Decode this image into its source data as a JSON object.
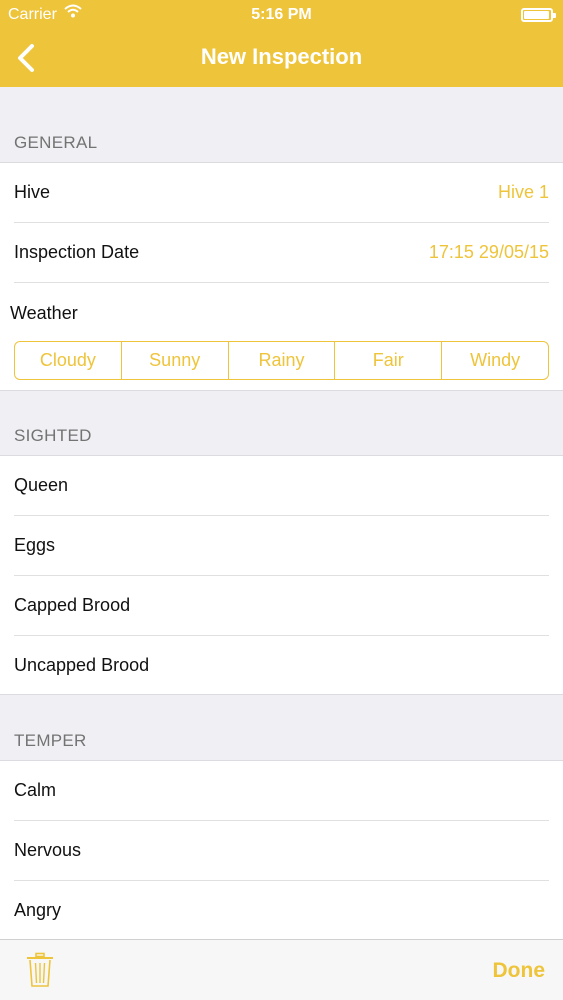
{
  "status_bar": {
    "carrier": "Carrier",
    "time": "5:16 PM",
    "battery_level": 0.95
  },
  "nav": {
    "title": "New Inspection",
    "back_icon": "chevron-left-icon"
  },
  "general": {
    "title": "GENERAL",
    "hive": {
      "label": "Hive",
      "value": "Hive 1"
    },
    "date": {
      "label": "Inspection Date",
      "value": "17:15 29/05/15"
    },
    "weather": {
      "label": "Weather",
      "options": [
        "Cloudy",
        "Sunny",
        "Rainy",
        "Fair",
        "Windy"
      ]
    }
  },
  "sighted": {
    "title": "SIGHTED",
    "items": [
      "Queen",
      "Eggs",
      "Capped Brood",
      "Uncapped Brood"
    ]
  },
  "temper": {
    "title": "TEMPER",
    "items": [
      "Calm",
      "Nervous",
      "Angry"
    ]
  },
  "toolbar": {
    "trash_icon": "trash-icon",
    "done_label": "Done"
  },
  "colors": {
    "accent": "#eec43b",
    "background": "#efeff4",
    "section_text": "#737373"
  }
}
